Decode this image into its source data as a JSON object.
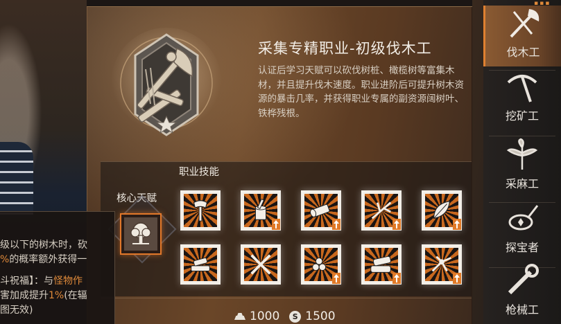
{
  "job": {
    "title": "采集专精职业-初级伐木工",
    "description": "认证后学习天赋可以砍伐树桩、橄榄树等富集木材，并且提升伐木速度。职业进阶后可提升树木资源的暴击几率，并获得职业专属的副资源阔树叶、铁桦残根。"
  },
  "skills": {
    "header": "职业技能",
    "core_label": "核心天赋",
    "rows": [
      [
        "axe-skill-icon",
        "stump-skill-icon",
        "log-skill-icon",
        "branch-skill-icon",
        "leaf-skill-icon"
      ],
      [
        "wood-pile-skill-icon",
        "crossed-axes-skill-icon",
        "logs-skill-icon",
        "log-stack-skill-icon",
        "splinter-skill-icon"
      ]
    ]
  },
  "tooltip": {
    "line1": "级以下的树木时，砍",
    "line2_hl": "%",
    "line2": "的概率额外获得一",
    "line3": "斗祝福】：与",
    "line3_hl": "怪物作",
    "line4": "害加成提升",
    "line4_hl": "1%",
    "line4_end": "(在辐",
    "line5": "图无效)"
  },
  "currency": {
    "ingot_amount": "1000",
    "coin_symbol": "S",
    "coin_amount": "1500"
  },
  "nav": {
    "items": [
      {
        "label": "伐木工",
        "icon": "lumberjack-axe-icon",
        "active": true
      },
      {
        "label": "挖矿工",
        "icon": "pickaxe-icon",
        "active": false
      },
      {
        "label": "采麻工",
        "icon": "hemp-leaf-icon",
        "active": false
      },
      {
        "label": "探宝者",
        "icon": "treasure-detector-icon",
        "active": false
      },
      {
        "label": "枪械工",
        "icon": "wrench-icon",
        "active": false
      }
    ]
  },
  "colors": {
    "accent": "#e07a28",
    "active_nav": "#8a5a32",
    "text": "#f2ede6"
  }
}
